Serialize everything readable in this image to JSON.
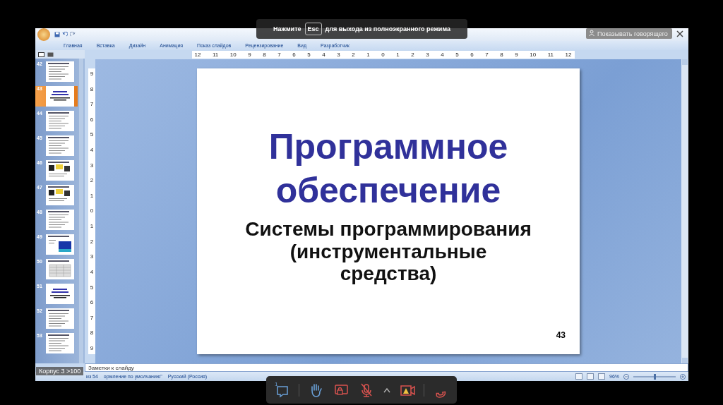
{
  "app": {
    "ribbon_tabs": [
      "Главная",
      "Вставка",
      "Дизайн",
      "Анимация",
      "Показ слайдов",
      "Рецензирование",
      "Вид",
      "Разработчик"
    ]
  },
  "slide_panel": {
    "slides": [
      {
        "number": "42",
        "selected": false,
        "kind": "text"
      },
      {
        "number": "43",
        "selected": true,
        "kind": "title"
      },
      {
        "number": "44",
        "selected": false,
        "kind": "text"
      },
      {
        "number": "45",
        "selected": false,
        "kind": "text"
      },
      {
        "number": "46",
        "selected": false,
        "kind": "image"
      },
      {
        "number": "47",
        "selected": false,
        "kind": "image"
      },
      {
        "number": "48",
        "selected": false,
        "kind": "text"
      },
      {
        "number": "49",
        "selected": false,
        "kind": "screen"
      },
      {
        "number": "50",
        "selected": false,
        "kind": "table"
      },
      {
        "number": "51",
        "selected": false,
        "kind": "title"
      },
      {
        "number": "52",
        "selected": false,
        "kind": "text"
      },
      {
        "number": "53",
        "selected": false,
        "kind": "text"
      }
    ]
  },
  "ruler": {
    "horizontal": [
      "12",
      "11",
      "10",
      "9",
      "8",
      "7",
      "6",
      "5",
      "4",
      "3",
      "2",
      "1",
      "0",
      "1",
      "2",
      "3",
      "4",
      "5",
      "6",
      "7",
      "8",
      "9",
      "10",
      "11",
      "12"
    ],
    "vertical": [
      "9",
      "8",
      "7",
      "6",
      "5",
      "4",
      "3",
      "2",
      "1",
      "0",
      "1",
      "2",
      "3",
      "4",
      "5",
      "6",
      "7",
      "8",
      "9"
    ]
  },
  "slide": {
    "title": "Программное обеспечение",
    "subtitle": "Системы программирования (инструментальные средства)",
    "number": "43"
  },
  "notes": {
    "placeholder": "Заметки к слайду"
  },
  "status_bar": {
    "items": [
      "из 54",
      "ормление по умолчанию\"",
      "Русский (Россия)"
    ],
    "zoom": "96%",
    "zoom_slider": {
      "level": 0.5
    }
  },
  "overlay": {
    "notice": {
      "before": "Нажмите",
      "key": "Esc",
      "after": "для выхода из полноэкранного режима"
    },
    "speaker_button": "Показывать говорящего",
    "room_label": "Корпус 3 >100",
    "call_toolbar": {
      "chat_badge": "1",
      "buttons": [
        {
          "kind": "chat"
        },
        {
          "kind": "separator"
        },
        {
          "kind": "hand"
        },
        {
          "kind": "screen"
        },
        {
          "kind": "mic"
        },
        {
          "kind": "caret"
        },
        {
          "kind": "camera"
        },
        {
          "kind": "separator"
        },
        {
          "kind": "hangup"
        }
      ]
    }
  }
}
